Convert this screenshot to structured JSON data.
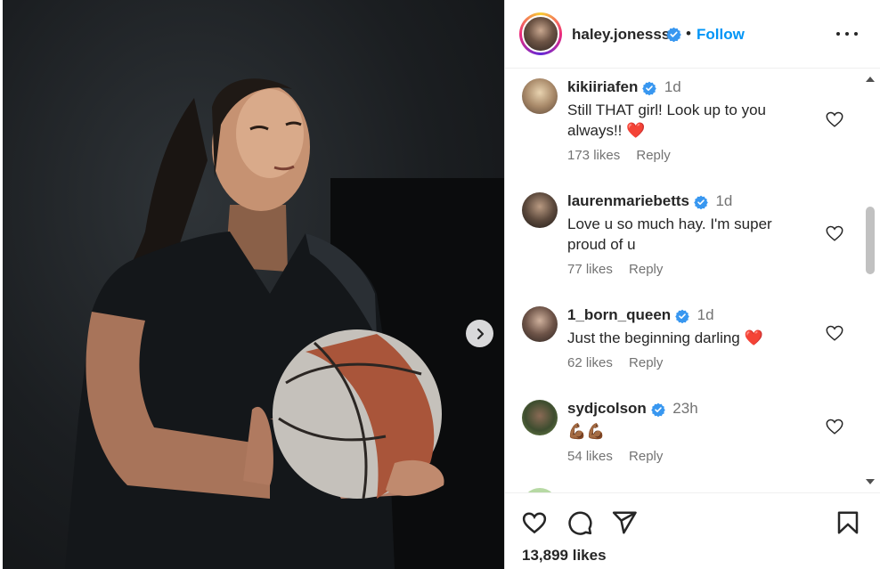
{
  "post": {
    "username": "haley.jonesss",
    "follow_label": "Follow",
    "likes": "13,899 likes"
  },
  "comments": [
    {
      "username": "kikiiriafen",
      "time": "1d",
      "text": "Still THAT girl! Look up to you always!! ❤️",
      "likes": "173 likes",
      "reply": "Reply"
    },
    {
      "username": "laurenmariebetts",
      "time": "1d",
      "text": "Love u so much hay. I'm super proud of u",
      "likes": "77 likes",
      "reply": "Reply"
    },
    {
      "username": "1_born_queen",
      "time": "1d",
      "text": "Just the beginning darling ❤️",
      "likes": "62 likes",
      "reply": "Reply"
    },
    {
      "username": "sydjcolson",
      "time": "23h",
      "text": "💪🏾💪🏾",
      "likes": "54 likes",
      "reply": "Reply"
    }
  ],
  "colors": {
    "accent": "#0095f6",
    "verified": "#3897f0",
    "heart_red": "#ed1c24"
  },
  "icons": [
    "verified-badge-icon",
    "more-options-icon",
    "heart-icon",
    "comment-icon",
    "share-icon",
    "bookmark-icon",
    "chevron-right-icon",
    "scroll-up-icon",
    "scroll-down-icon"
  ]
}
